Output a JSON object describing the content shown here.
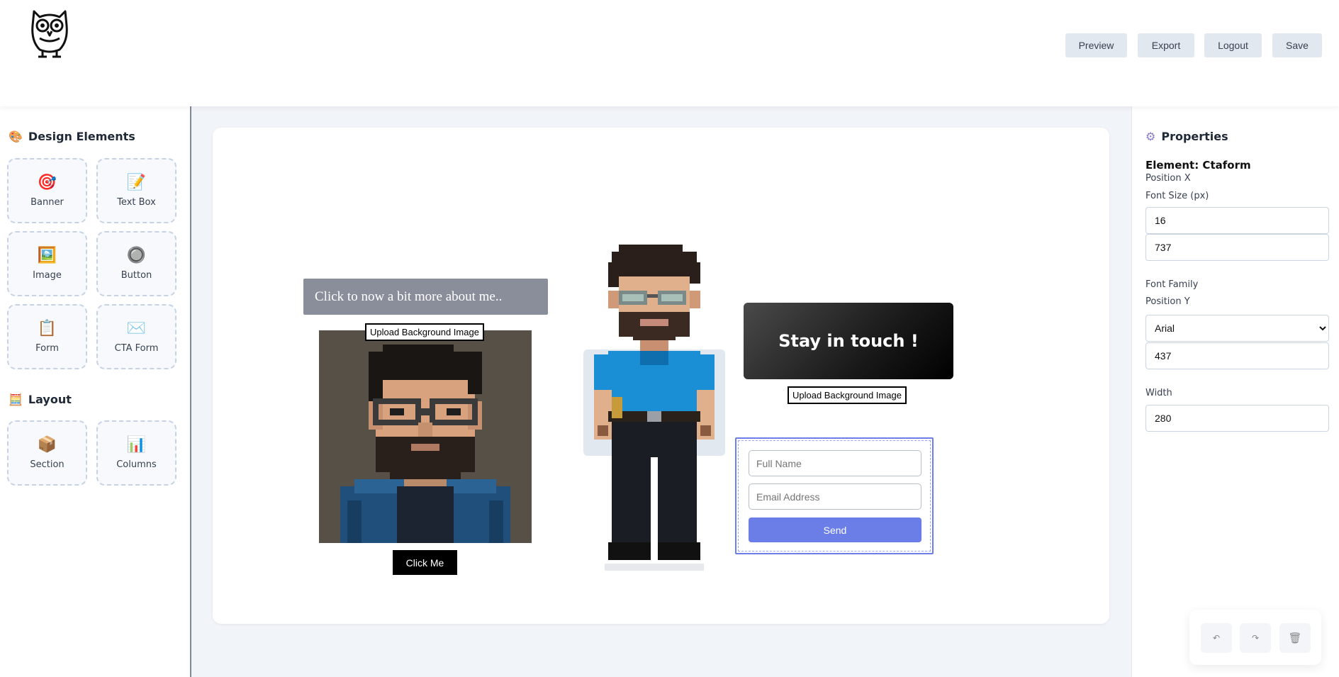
{
  "header": {
    "logo_icon": "owl-logo-icon",
    "buttons": {
      "preview": "Preview",
      "export": "Export",
      "logout": "Logout",
      "save": "Save"
    }
  },
  "sidebar": {
    "design_title": "Design Elements",
    "design_icon": "palette-icon",
    "design_items": [
      {
        "label": "Banner",
        "icon": "target-icon",
        "glyph": "🎯"
      },
      {
        "label": "Text Box",
        "icon": "memo-icon",
        "glyph": "📝"
      },
      {
        "label": "Image",
        "icon": "picture-icon",
        "glyph": "🖼️"
      },
      {
        "label": "Button",
        "icon": "circle-button-icon",
        "glyph": "🔘"
      },
      {
        "label": "Form",
        "icon": "clipboard-icon",
        "glyph": "📋"
      },
      {
        "label": "CTA Form",
        "icon": "cta-form-icon",
        "glyph": "✉️"
      }
    ],
    "layout_title": "Layout",
    "layout_icon": "abacus-icon",
    "layout_items": [
      {
        "label": "Section",
        "icon": "package-icon",
        "glyph": "📦"
      },
      {
        "label": "Columns",
        "icon": "bar-chart-icon",
        "glyph": "📊"
      }
    ]
  },
  "canvas": {
    "text_box": "Click to now a bit more about me..",
    "upload_bg_label_1": "Upload Background Image",
    "upload_bg_label_2": "Upload Background Image",
    "click_me": "Click Me",
    "banner_text": "Stay in touch !",
    "form": {
      "name_placeholder": "Full Name",
      "email_placeholder": "Email Address",
      "send_label": "Send"
    }
  },
  "properties": {
    "title": "Properties",
    "title_icon": "gear-icon",
    "element_label": "Element: Ctaform",
    "position_x_label": "Position X",
    "font_size_label": "Font Size (px)",
    "font_size_value": "16",
    "position_x_value": "737",
    "font_family_label": "Font Family",
    "position_y_label": "Position Y",
    "font_family_value": "Arial",
    "position_y_value": "437",
    "width_label": "Width",
    "width_value": "280"
  },
  "actions": {
    "undo_icon": "undo-icon",
    "redo_icon": "redo-icon",
    "delete_icon": "trash-icon"
  }
}
